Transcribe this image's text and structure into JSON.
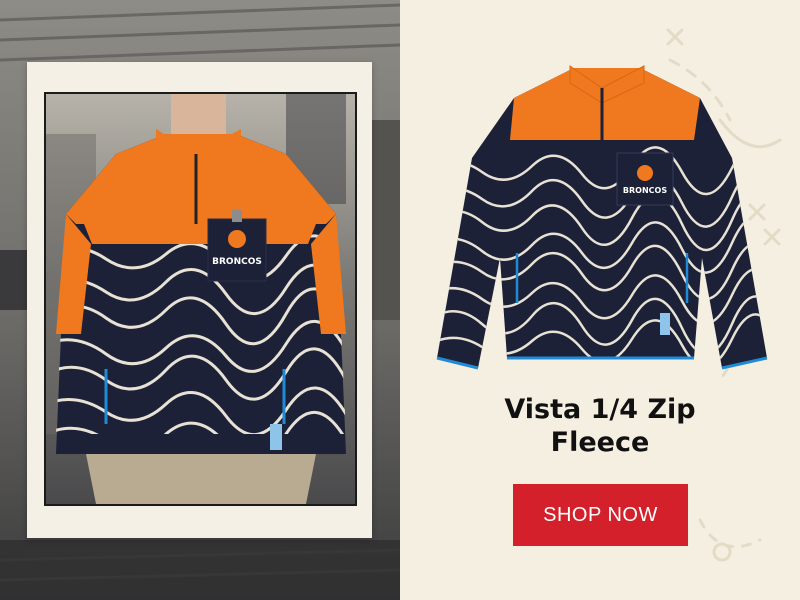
{
  "product": {
    "name_line1": "Vista 1/4 Zip",
    "name_line2": "Fleece",
    "logo_text": "BRONCOS"
  },
  "cta": {
    "label": "SHOP NOW"
  },
  "colors": {
    "background": "#f4efe1",
    "orange": "#f0781e",
    "navy": "#1c2138",
    "cta_red": "#d3202a",
    "accent_blue": "#1f8ad6"
  }
}
